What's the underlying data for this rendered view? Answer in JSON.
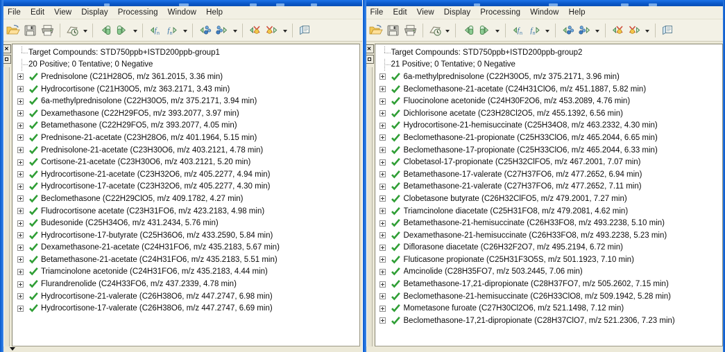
{
  "windows": [
    {
      "id": "left",
      "menu": [
        "File",
        "Edit",
        "View",
        "Display",
        "Processing",
        "Window",
        "Help"
      ],
      "toolbar": [
        {
          "name": "open-folder-icon",
          "dropdown": false
        },
        {
          "name": "save-disk-icon",
          "dropdown": false
        },
        {
          "name": "print-icon",
          "dropdown": false
        },
        {
          "separator": true
        },
        {
          "name": "recent-history-icon",
          "dropdown": true
        },
        {
          "separator": true
        },
        {
          "name": "previous-sample-icon",
          "dropdown": false
        },
        {
          "name": "next-sample-icon",
          "dropdown": true
        },
        {
          "separator": true
        },
        {
          "name": "previous-function-icon",
          "dropdown": false
        },
        {
          "name": "next-function-icon",
          "dropdown": true
        },
        {
          "separator": true
        },
        {
          "name": "previous-compound-icon",
          "dropdown": false
        },
        {
          "name": "next-compound-icon",
          "dropdown": true
        },
        {
          "separator": true
        },
        {
          "name": "previous-review-icon",
          "dropdown": false
        },
        {
          "name": "next-review-icon",
          "dropdown": true
        },
        {
          "separator": true
        },
        {
          "name": "browse-book-icon",
          "dropdown": false
        }
      ],
      "dock": {
        "close_label": "x",
        "restore_label": "restore"
      },
      "tree": {
        "title": "Target Compounds: STD750ppb+ISTD200ppb-group1",
        "summary": "20 Positive; 0 Tentative; 0 Negative",
        "items": [
          "Prednisolone (C21H28O5, m/z 361.2015, 3.36 min)",
          "Hydrocortisone (C21H30O5, m/z 363.2171, 3.43 min)",
          "6a-methylprednisolone (C22H30O5, m/z 375.2171, 3.94 min)",
          "Dexamethasone (C22H29FO5, m/z 393.2077, 3.97 min)",
          "Betamethasone (C22H29FO5, m/z 393.2077, 4.05 min)",
          "Prednisone-21-acetate (C23H28O6, m/z 401.1964, 5.15 min)",
          "Prednisolone-21-acetate (C23H30O6, m/z 403.2121, 4.78 min)",
          "Cortisone-21-acetate (C23H30O6, m/z 403.2121, 5.20 min)",
          "Hydrocortisone-21-acetate (C23H32O6, m/z 405.2277, 4.94 min)",
          "Hydrocortisone-17-acetate (C23H32O6, m/z 405.2277, 4.30 min)",
          "Beclomethasone (C22H29ClO5, m/z 409.1782, 4.27 min)",
          "Fludrocortisone acetate (C23H31FO6, m/z 423.2183, 4.98 min)",
          "Budesonide (C25H34O6, m/z 431.2434, 5.76 min)",
          "Hydrocortisone-17-butyrate (C25H36O6, m/z 433.2590, 5.84 min)",
          "Dexamethasone-21-acetate (C24H31FO6, m/z 435.2183, 5.67 min)",
          "Betamethasone-21-acetate (C24H31FO6, m/z 435.2183, 5.51 min)",
          "Triamcinolone acetonide (C24H31FO6, m/z 435.2183, 4.44 min)",
          "Flurandrenolide (C24H33FO6, m/z 437.2339, 4.78 min)",
          "Hydrocortisone-21-valerate (C26H38O6, m/z 447.2747, 6.98 min)",
          "Hydrocortisone-17-valerate (C26H38O6, m/z 447.2747, 6.69 min)"
        ]
      }
    },
    {
      "id": "right",
      "menu": [
        "File",
        "Edit",
        "View",
        "Display",
        "Processing",
        "Window",
        "Help"
      ],
      "toolbar": [
        {
          "name": "open-folder-icon",
          "dropdown": false
        },
        {
          "name": "save-disk-icon",
          "dropdown": false
        },
        {
          "name": "print-icon",
          "dropdown": false
        },
        {
          "separator": true
        },
        {
          "name": "recent-history-icon",
          "dropdown": true
        },
        {
          "separator": true
        },
        {
          "name": "previous-sample-icon",
          "dropdown": false
        },
        {
          "name": "next-sample-icon",
          "dropdown": true
        },
        {
          "separator": true
        },
        {
          "name": "previous-function-icon",
          "dropdown": false
        },
        {
          "name": "next-function-icon",
          "dropdown": true
        },
        {
          "separator": true
        },
        {
          "name": "previous-compound-icon",
          "dropdown": false
        },
        {
          "name": "next-compound-icon",
          "dropdown": true
        },
        {
          "separator": true
        },
        {
          "name": "previous-review-icon",
          "dropdown": false
        },
        {
          "name": "next-review-icon",
          "dropdown": true
        },
        {
          "separator": true
        },
        {
          "name": "browse-book-icon",
          "dropdown": false
        }
      ],
      "dock": {
        "close_label": "x",
        "restore_label": "restore"
      },
      "tree": {
        "title": "Target Compounds: STD750ppb+ISTD200ppb-group2",
        "summary": "21 Positive; 0 Tentative; 0 Negative",
        "items": [
          "6a-methylprednisolone (C22H30O5, m/z 375.2171, 3.96 min)",
          "Beclomethasone-21-acetate (C24H31ClO6, m/z 451.1887, 5.82 min)",
          "Fluocinolone acetonide (C24H30F2O6, m/z 453.2089, 4.76 min)",
          "Dichlorisone acetate (C23H28Cl2O5, m/z 455.1392, 6.56 min)",
          "Hydrocortisone-21-hemisuccinate (C25H34O8, m/z 463.2332, 4.30 min)",
          "Beclomethasone-21-propionate (C25H33ClO6, m/z 465.2044, 6.65 min)",
          "Beclomethasone-17-propionate (C25H33ClO6, m/z 465.2044, 6.33 min)",
          "Clobetasol-17-propionate (C25H32ClFO5, m/z 467.2001, 7.07 min)",
          "Betamethasone-17-valerate (C27H37FO6, m/z 477.2652, 6.94 min)",
          "Betamethasone-21-valerate (C27H37FO6, m/z 477.2652, 7.11 min)",
          "Clobetasone butyrate (C26H32ClFO5, m/z 479.2001, 7.27 min)",
          "Triamcinolone diacetate (C25H31FO8, m/z 479.2081, 4.62 min)",
          "Betamethasone-21-hemisuccinate (C26H33FO8, m/z 493.2238, 5.10 min)",
          "Dexamethasone-21-hemisuccinate (C26H33FO8, m/z 493.2238, 5.23 min)",
          "Diflorasone diacetate (C26H32F2O7, m/z 495.2194, 6.72 min)",
          "Fluticasone propionate (C25H31F3O5S, m/z 501.1923, 7.10 min)",
          "Amcinolide (C28H35FO7, m/z 503.2445, 7.06 min)",
          "Betamethasone-17,21-dipropionate (C28H37FO7, m/z 505.2602, 7.15 min)",
          "Beclomethasone-21-hemisuccinate (C26H33ClO8, m/z 509.1942, 5.28 min)",
          "Mometasone furoate (C27H30Cl2O6, m/z 521.1498, 7.12 min)",
          "Beclomethasone-17,21-dipropionate (C28H37ClO7, m/z 521.2306, 7.23 min)"
        ]
      }
    }
  ],
  "colors": {
    "title_bar": "#0a57c6",
    "toolbar_bg": "#f3f1e6",
    "window_bg": "#ece9d8",
    "tree_bg": "#ffffff",
    "check_green": "#2f9e35",
    "text": "#0c0c0c"
  }
}
